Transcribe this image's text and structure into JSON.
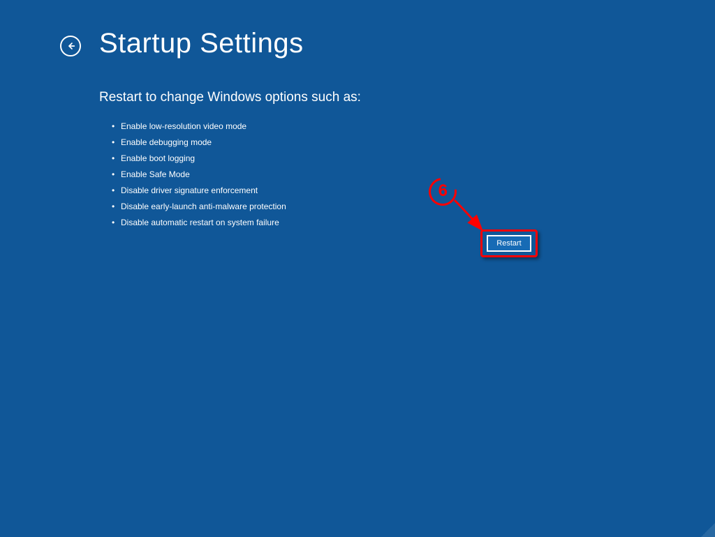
{
  "header": {
    "title": "Startup Settings"
  },
  "content": {
    "subtitle": "Restart to change Windows options such as:",
    "options": [
      "Enable low-resolution video mode",
      "Enable debugging mode",
      "Enable boot logging",
      "Enable Safe Mode",
      "Disable driver signature enforcement",
      "Disable early-launch anti-malware protection",
      "Disable automatic restart on system failure"
    ]
  },
  "buttons": {
    "restart": "Restart"
  },
  "annotation": {
    "step_number": "6"
  }
}
